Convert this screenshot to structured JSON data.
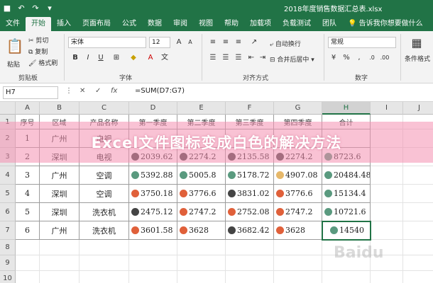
{
  "window": {
    "doc_title": "2018年度销售数据汇总表 - Excel",
    "doc_title_visible": "2018年度销售数据汇总表.xlsx"
  },
  "tabs": [
    "文件",
    "开始",
    "插入",
    "页面布局",
    "公式",
    "数据",
    "审阅",
    "视图",
    "帮助",
    "加载项",
    "负载测试",
    "团队"
  ],
  "active_tab": "开始",
  "tell_me": "告诉我你想要做什么",
  "ribbon": {
    "clipboard": {
      "label": "剪贴板",
      "cut": "剪切",
      "copy": "复制",
      "format_painter": "格式刷",
      "paste": "粘贴"
    },
    "font": {
      "label": "字体",
      "name": "宋体",
      "size": "12"
    },
    "alignment": {
      "label": "对齐方式",
      "wrap": "自动换行",
      "merge": "合并后居中"
    },
    "number": {
      "label": "数字",
      "format": "常规"
    },
    "styles": {
      "conditional": "条件格式"
    }
  },
  "formula_bar": {
    "name_box": "H7",
    "formula": "=SUM(D7:G7)"
  },
  "columns": [
    "A",
    "B",
    "C",
    "D",
    "E",
    "F",
    "G",
    "H",
    "I",
    "J"
  ],
  "selected_column": "H",
  "table": {
    "headers": [
      "序号",
      "区域",
      "产品名称",
      "第一季度",
      "第二季度",
      "第三季度",
      "第四季度",
      "合计"
    ],
    "rows": [
      {
        "row": "2",
        "cells": [
          "1",
          "广州",
          "电视",
          "",
          "",
          "",
          "",
          ""
        ]
      },
      {
        "row": "3",
        "cells": [
          "2",
          "深圳",
          "电视",
          "2039.62",
          "2274.2",
          "2135.58",
          "2274.2",
          "8723.6"
        ]
      },
      {
        "row": "4",
        "cells": [
          "3",
          "广州",
          "空调",
          "5392.88",
          "5005.8",
          "5178.72",
          "4907.08",
          "20484.48"
        ]
      },
      {
        "row": "5",
        "cells": [
          "4",
          "深圳",
          "空调",
          "3750.18",
          "3776.6",
          "3831.02",
          "3776.6",
          "15134.4"
        ]
      },
      {
        "row": "6",
        "cells": [
          "5",
          "深圳",
          "洗衣机",
          "2475.12",
          "2747.2",
          "2752.08",
          "2747.2",
          "10721.6"
        ]
      },
      {
        "row": "7",
        "cells": [
          "6",
          "广州",
          "洗衣机",
          "3601.58",
          "3628",
          "3682.42",
          "3628",
          "14540"
        ]
      }
    ],
    "dot_colors": [
      [
        "#444444",
        "#444444",
        "#444444",
        "#444444",
        "#5a9a7f"
      ],
      [
        "#5a9a7f",
        "#5a9a7f",
        "#5a9a7f",
        "#e6b86a",
        "#5a9a7f"
      ],
      [
        "#e0603a",
        "#e0603a",
        "#444444",
        "#e0603a",
        "#5a9a7f"
      ],
      [
        "#444444",
        "#e0603a",
        "#e0603a",
        "#e0603a",
        "#5a9a7f"
      ],
      [
        "#e0603a",
        "#e0603a",
        "#444444",
        "#e0603a",
        "#5a9a7f"
      ]
    ]
  },
  "banner": "Excel文件图标变成白色的解决方法",
  "watermark": "Baidu"
}
